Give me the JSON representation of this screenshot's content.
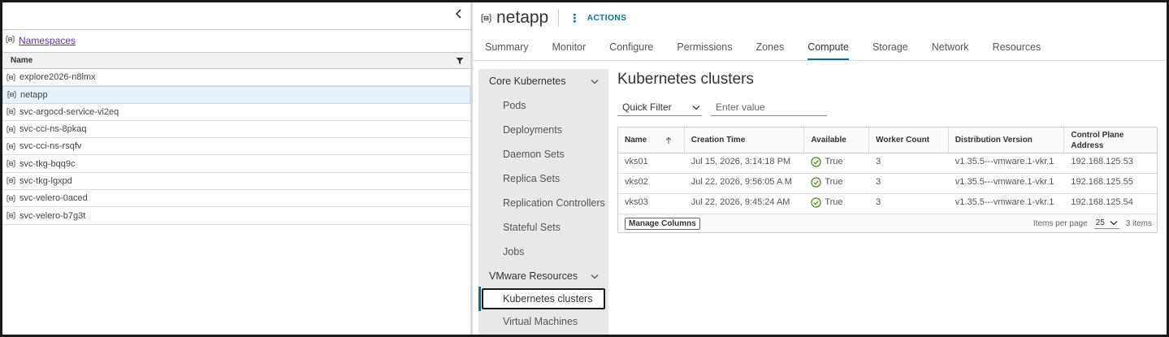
{
  "left": {
    "breadcrumb_link": "Namespaces",
    "column_header": "Name",
    "namespaces": [
      {
        "label": "explore2026-n8lmx",
        "selected": false
      },
      {
        "label": "netapp",
        "selected": true
      },
      {
        "label": "svc-argocd-service-vi2eq",
        "selected": false
      },
      {
        "label": "svc-cci-ns-8pkaq",
        "selected": false
      },
      {
        "label": "svc-cci-ns-rsqfv",
        "selected": false
      },
      {
        "label": "svc-tkg-bqq9c",
        "selected": false
      },
      {
        "label": "svc-tkg-lgxpd",
        "selected": false
      },
      {
        "label": "svc-velero-0aced",
        "selected": false
      },
      {
        "label": "svc-velero-b7g3t",
        "selected": false
      }
    ]
  },
  "header": {
    "title": "netapp",
    "actions_label": "ACTIONS"
  },
  "tabs": [
    "Summary",
    "Monitor",
    "Configure",
    "Permissions",
    "Zones",
    "Compute",
    "Storage",
    "Network",
    "Resources"
  ],
  "active_tab": "Compute",
  "subnav": {
    "core_section": "Core Kubernetes",
    "core_items": [
      "Pods",
      "Deployments",
      "Daemon Sets",
      "Replica Sets",
      "Replication Controllers",
      "Stateful Sets",
      "Jobs"
    ],
    "vmware_section": "VMware Resources",
    "vmware_items": [
      "Kubernetes clusters",
      "Virtual Machines"
    ],
    "active_item": "Kubernetes clusters"
  },
  "content": {
    "title": "Kubernetes clusters",
    "quick_filter_label": "Quick Filter",
    "filter_placeholder": "Enter value",
    "columns": [
      "Name",
      "Creation Time",
      "Available",
      "Worker Count",
      "Distribution Version",
      "Control Plane Address"
    ],
    "rows": [
      {
        "name": "vks01",
        "created": "Jul 15, 2026, 3:14:18 PM",
        "available": "True",
        "workers": "3",
        "version": "v1.35.5---vmware.1-vkr.1",
        "address": "192.168.125.53"
      },
      {
        "name": "vks02",
        "created": "Jul 22, 2026, 9:56:05 A M",
        "available": "True",
        "workers": "3",
        "version": "v1.35.5---vmware.1-vkr.1",
        "address": "192.168.125.55"
      },
      {
        "name": "vks03",
        "created": "Jul 22, 2026, 9:45:24 AM",
        "available": "True",
        "workers": "3",
        "version": "v1.35.5---vmware.1-vkr.1",
        "address": "192.168.125.54"
      }
    ],
    "manage_columns": "Manage Columns",
    "items_per_page_label": "Items per page",
    "items_per_page": "25",
    "item_count": "3 items"
  },
  "colors": {
    "accent": "#0072a3",
    "link": "#6b2da8",
    "success": "#3c8500"
  }
}
